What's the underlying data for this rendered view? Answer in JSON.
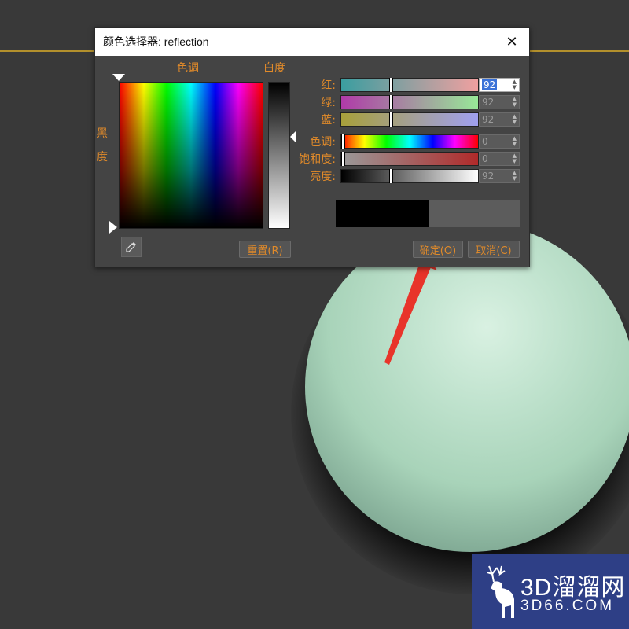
{
  "dialog": {
    "title": "颜色选择器: reflection",
    "close_symbol": "✕",
    "hue_label": "色调",
    "whiteness_label": "白度",
    "blackness_label": "黑度",
    "reset_label": "重置(R)",
    "ok_label": "确定(O)",
    "cancel_label": "取消(C)"
  },
  "rows": [
    {
      "label": "红:",
      "value": "92",
      "active": true,
      "gradient": "linear-gradient(to right,#3a9ea0,#f0a0a0)",
      "thumb_fraction": 0.36
    },
    {
      "label": "绿:",
      "value": "92",
      "active": false,
      "gradient": "linear-gradient(to right,#b03aa8,#98e898)",
      "thumb_fraction": 0.36
    },
    {
      "label": "蓝:",
      "value": "92",
      "active": false,
      "gradient": "linear-gradient(to right,#a8a03a,#a0a0f0)",
      "thumb_fraction": 0.36
    },
    {
      "label": "色调:",
      "value": "0",
      "active": false,
      "gradient": "linear-gradient(to right,#f00,#ff0 17%,#0f0 33%,#0ff 50%,#00f 67%,#f0f 83%,#f00)",
      "thumb_fraction": 0.0
    },
    {
      "label": "饱和度:",
      "value": "0",
      "active": false,
      "gradient": "linear-gradient(to right,#9a9a9a,#b02a2a)",
      "thumb_fraction": 0.0
    },
    {
      "label": "亮度:",
      "value": "92",
      "active": false,
      "gradient": "linear-gradient(to right,#000,#fff)",
      "thumb_fraction": 0.36
    }
  ],
  "swatches": {
    "old_color": "#000000",
    "new_color": "#5c5c5c"
  },
  "colors": {
    "accent": "#e08a2a",
    "annotation_arrow": "#e8342a",
    "sphere": "#bfe2cd"
  },
  "watermark": {
    "main": "3D溜溜网",
    "sub": "3D66.COM"
  }
}
